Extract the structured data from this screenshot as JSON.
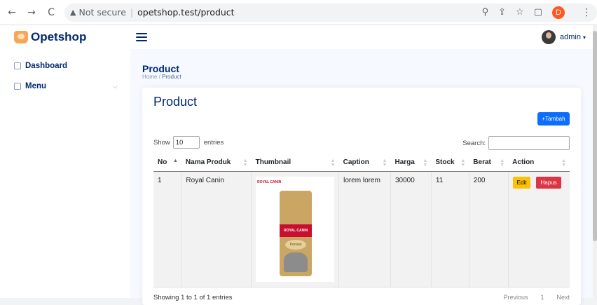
{
  "browser": {
    "back_icon": "←",
    "forward_icon": "→",
    "reload_icon": "C",
    "security_text": "Not secure",
    "url": "opetshop.test/product",
    "profile_letter": "D"
  },
  "app": {
    "brand": "Opetshop",
    "user_name": "admin"
  },
  "sidebar": {
    "items": [
      {
        "label": "Dashboard"
      },
      {
        "label": "Menu"
      }
    ]
  },
  "page": {
    "title": "Product",
    "breadcrumb_home": "Home",
    "breadcrumb_sep": "/",
    "breadcrumb_current": "Product"
  },
  "card": {
    "title": "Product",
    "add_button": "+Tambah",
    "show_label": "Show",
    "entries_value": "10",
    "entries_label": "entries",
    "search_label": "Search:",
    "columns": [
      "No",
      "Nama Produk",
      "Thumbnail",
      "Caption",
      "Harga",
      "Stock",
      "Berat",
      "Action"
    ],
    "rows": [
      {
        "no": "1",
        "nama": "Royal Canin",
        "caption": "lorem lorem",
        "harga": "30000",
        "stock": "11",
        "berat": "200",
        "edit": "Edit",
        "hapus": "Hapus"
      }
    ],
    "footer_info": "Showing 1 to 1 of 1 entries",
    "pager_prev": "Previous",
    "pager_page": "1",
    "pager_next": "Next"
  },
  "thumbnail_image": {
    "logo_text": "ROYAL CANIN",
    "band_text": "ROYAL CANIN",
    "variant_text": "Persian"
  },
  "colors": {
    "brand": "#012970",
    "primary": "#0d6efd",
    "warning": "#ffc107",
    "danger": "#dc3545"
  }
}
